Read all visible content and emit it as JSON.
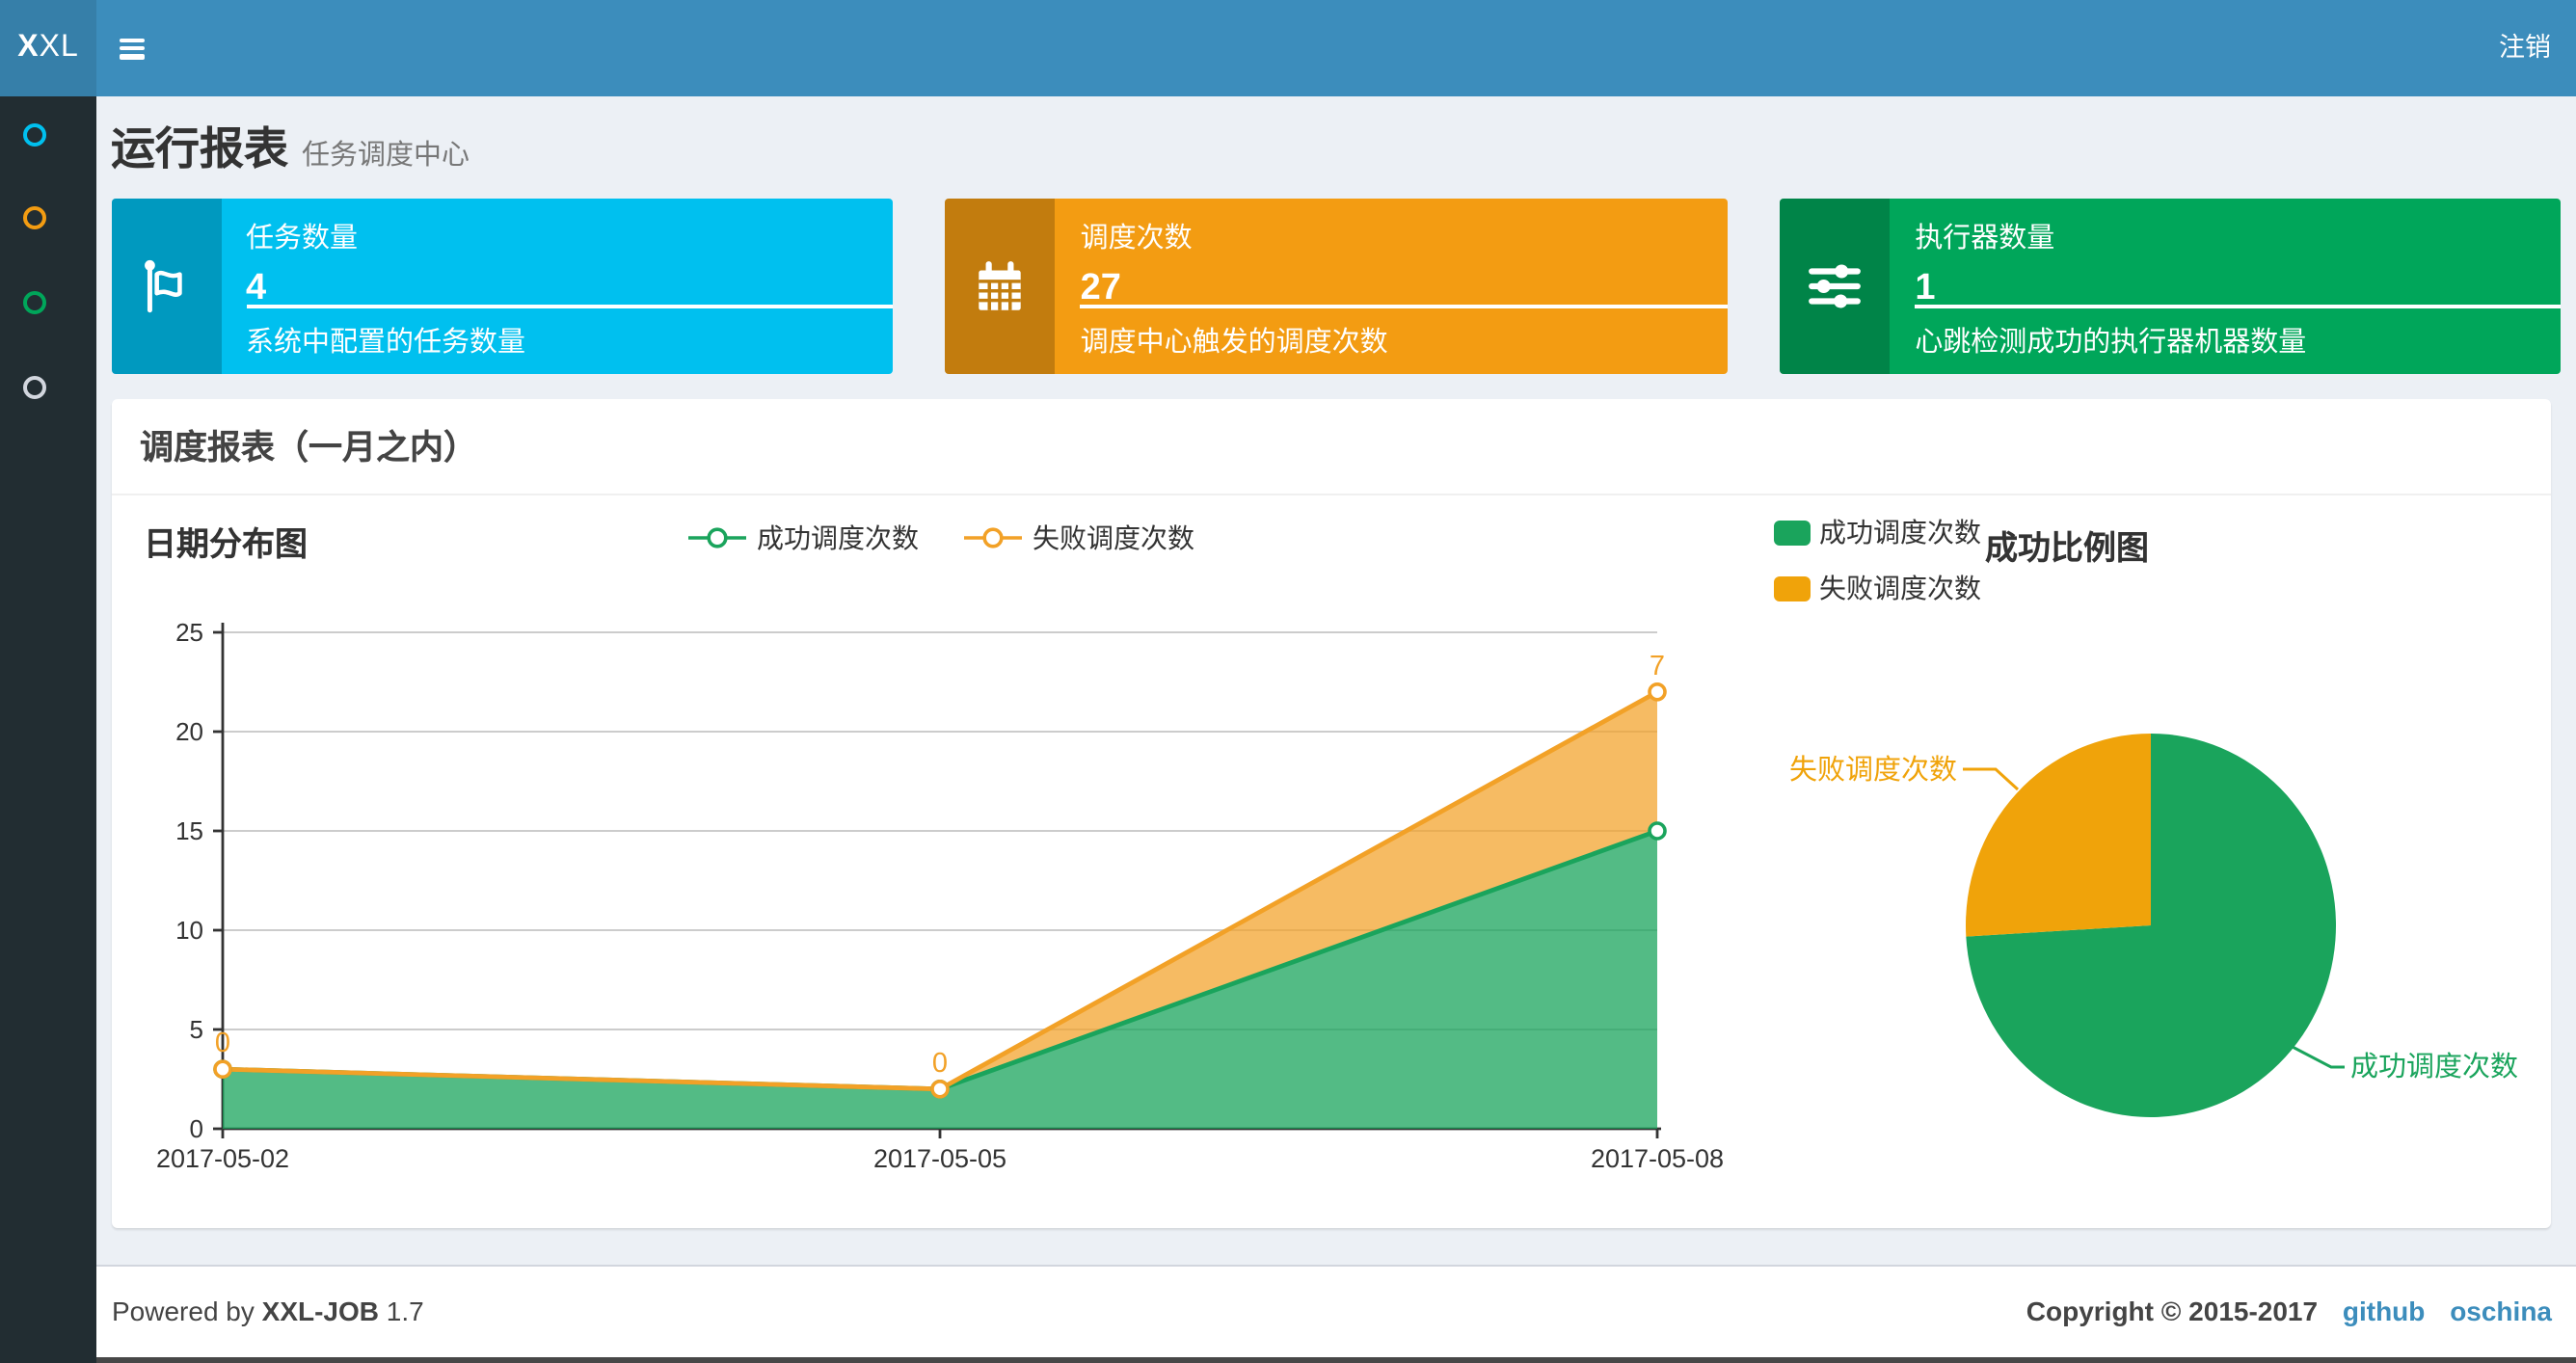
{
  "navbar": {
    "logo_bold": "X",
    "logo_rest": "XL",
    "logout_label": "注销"
  },
  "sidebar": {
    "items": [
      {
        "name": "menu-item-1",
        "icon": "circle-icon",
        "color": "#00c0ef"
      },
      {
        "name": "menu-item-2",
        "icon": "circle-icon",
        "color": "#f39c12"
      },
      {
        "name": "menu-item-3",
        "icon": "circle-icon",
        "color": "#00a65a"
      },
      {
        "name": "menu-item-4",
        "icon": "circle-icon",
        "color": "#d2d6de"
      }
    ]
  },
  "page_header": {
    "title": "运行报表",
    "subtitle": "任务调度中心"
  },
  "info_boxes": [
    {
      "label": "任务数量",
      "value": "4",
      "description": "系统中配置的任务数量",
      "color": "#00c0ef",
      "icon": "flag-icon"
    },
    {
      "label": "调度次数",
      "value": "27",
      "description": "调度中心触发的调度次数",
      "color": "#f39c12",
      "icon": "calendar-icon"
    },
    {
      "label": "执行器数量",
      "value": "1",
      "description": "心跳检测成功的执行器机器数量",
      "color": "#00a65a",
      "icon": "sliders-icon"
    }
  ],
  "panel": {
    "title": "调度报表（一月之内）"
  },
  "chart_data": [
    {
      "type": "area",
      "title": "日期分布图",
      "x": [
        "2017-05-02",
        "2017-05-05",
        "2017-05-08"
      ],
      "series": [
        {
          "name": "成功调度次数",
          "values": [
            3,
            2,
            15
          ],
          "color": "#1aa45c",
          "fill": "rgba(26,164,92,0.75)"
        },
        {
          "name": "失败调度次数",
          "values": [
            0,
            0,
            7
          ],
          "color": "#f2a127",
          "fill": "rgba(242,161,39,0.72)"
        }
      ],
      "stacked": true,
      "ylim": [
        0,
        25
      ],
      "yticks": [
        0,
        5,
        10,
        15,
        20,
        25
      ],
      "point_labels": [
        "0",
        "0",
        "7"
      ],
      "legend_position": "top-center",
      "grid": true
    },
    {
      "type": "pie",
      "title": "成功比例图",
      "slices": [
        {
          "name": "成功调度次数",
          "value": 20,
          "color": "#1aa45c"
        },
        {
          "name": "失败调度次数",
          "value": 7,
          "color": "#f0a30a"
        }
      ],
      "legend_position": "top-left"
    }
  ],
  "footer": {
    "powered_prefix": "Powered by ",
    "product": "XXL-JOB",
    "version": " 1.7",
    "copyright": "Copyright © 2015-2017",
    "links": [
      {
        "label": "github"
      },
      {
        "label": "oschina"
      }
    ],
    "link_color": "#3c8dbc"
  }
}
